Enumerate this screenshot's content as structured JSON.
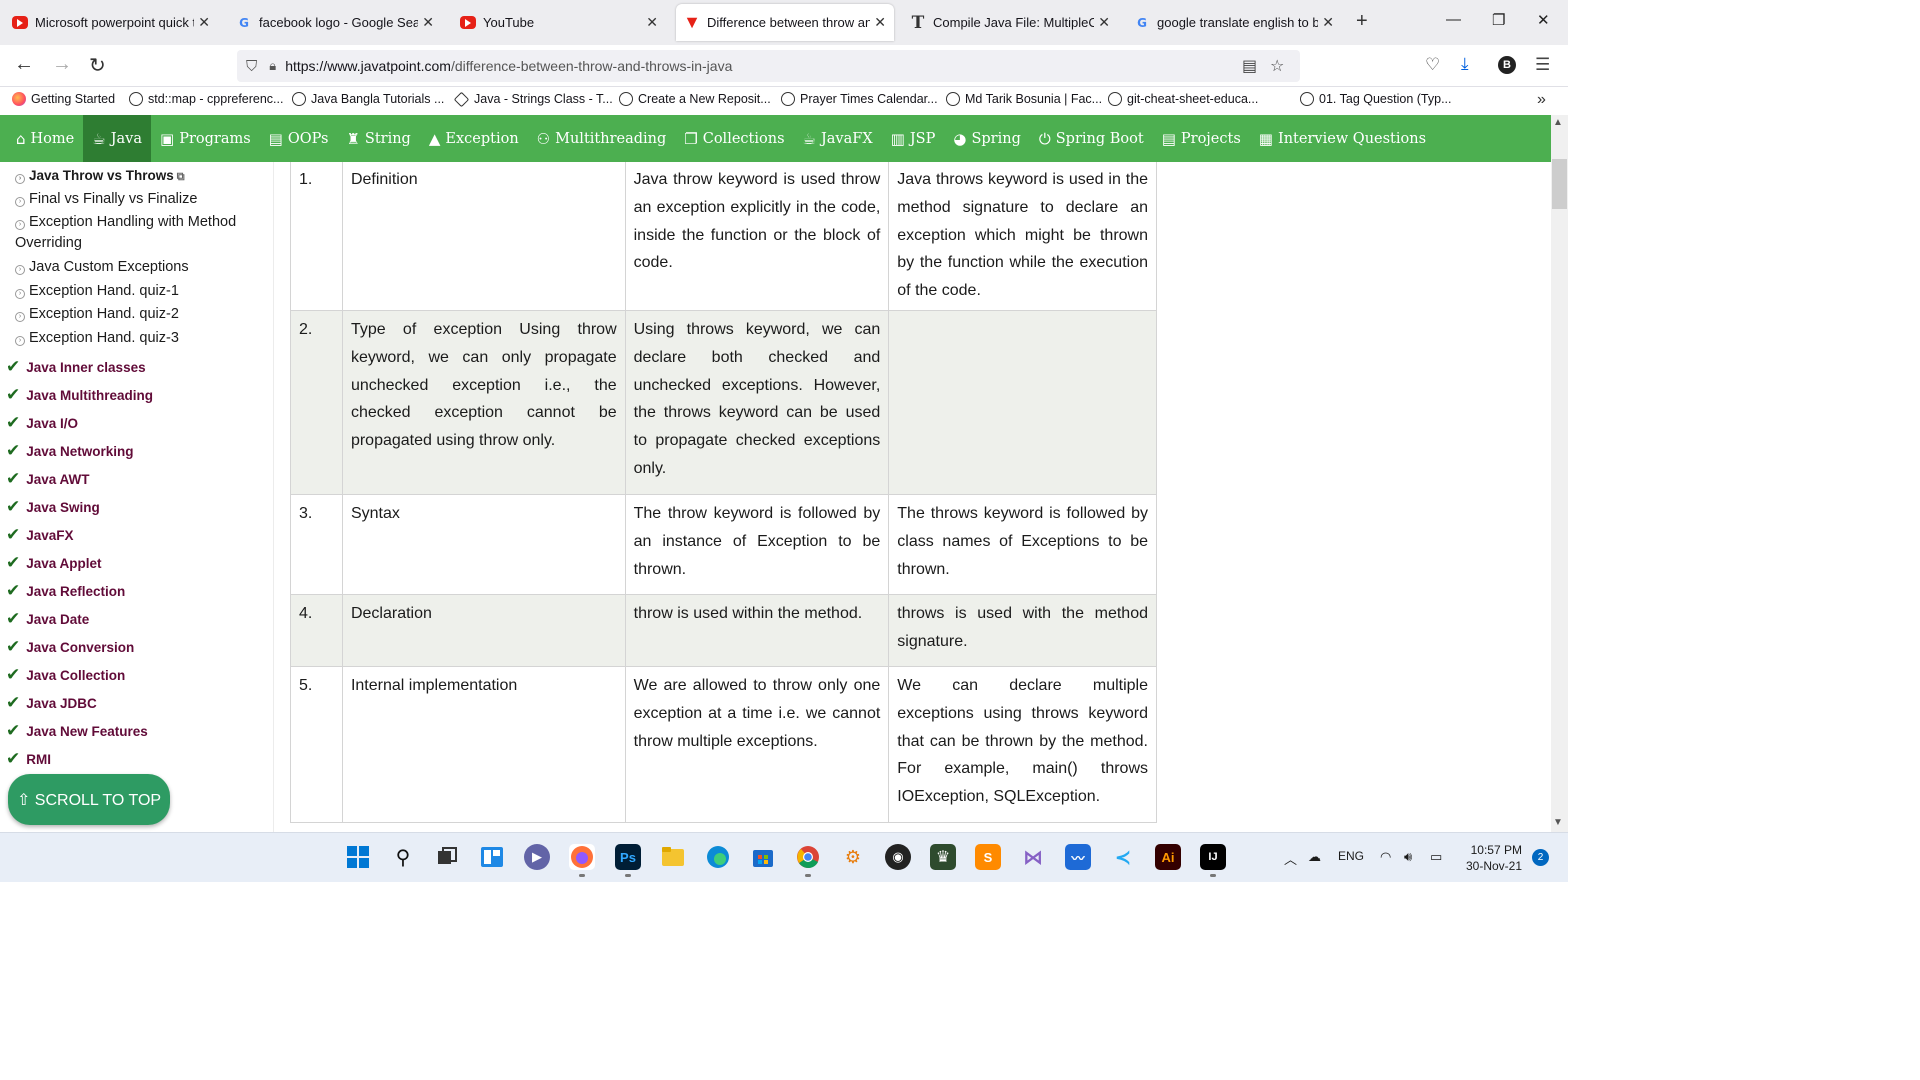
{
  "browser": {
    "tabs": [
      {
        "title": "Microsoft powerpoint quick tu",
        "favicon": "youtube-icon",
        "active": false
      },
      {
        "title": "facebook logo - Google Searc",
        "favicon": "google-icon",
        "active": false
      },
      {
        "title": "YouTube",
        "favicon": "youtube-icon",
        "active": false
      },
      {
        "title": "Difference between throw and",
        "favicon": "javatpoint-icon",
        "active": true
      },
      {
        "title": "Compile Java File: MultipleCat",
        "favicon": "t-icon",
        "active": false
      },
      {
        "title": "google translate english to ban",
        "favicon": "google-icon",
        "active": false
      }
    ],
    "url": {
      "domain": "https://www.javatpoint.com",
      "path": "/difference-between-throw-and-throws-in-java"
    },
    "avatar_letter": "B",
    "bookmarks": [
      "Getting Started",
      "std::map - cppreferenc...",
      "Java Bangla Tutorials ...",
      "Java - Strings Class - T...",
      "Create a New Reposit...",
      "Prayer Times Calendar...",
      "Md Tarik Bosunia | Fac...",
      "git-cheat-sheet-educa...",
      "01. Tag Question (Typ..."
    ]
  },
  "site_menu": [
    {
      "label": "Home",
      "icon": "home-icon",
      "active": false
    },
    {
      "label": "Java",
      "icon": "java-cup-icon",
      "active": true
    },
    {
      "label": "Programs",
      "icon": "programs-icon",
      "active": false
    },
    {
      "label": "OOPs",
      "icon": "oops-icon",
      "active": false
    },
    {
      "label": "String",
      "icon": "string-icon",
      "active": false
    },
    {
      "label": "Exception",
      "icon": "warning-icon",
      "active": false
    },
    {
      "label": "Multithreading",
      "icon": "multithreading-icon",
      "active": false
    },
    {
      "label": "Collections",
      "icon": "collections-icon",
      "active": false
    },
    {
      "label": "JavaFX",
      "icon": "javafx-icon",
      "active": false
    },
    {
      "label": "JSP",
      "icon": "jsp-icon",
      "active": false
    },
    {
      "label": "Spring",
      "icon": "spring-icon",
      "active": false
    },
    {
      "label": "Spring Boot",
      "icon": "spring-boot-icon",
      "active": false
    },
    {
      "label": "Projects",
      "icon": "projects-icon",
      "active": false
    },
    {
      "label": "Interview Questions",
      "icon": "interview-icon",
      "active": false
    }
  ],
  "sidebar": {
    "sub_items": [
      "Java Throw vs Throws",
      "Final vs Finally vs Finalize",
      "Exception Handling with Method Overriding",
      "Java Custom Exceptions",
      "Exception Hand. quiz-1",
      "Exception Hand. quiz-2",
      "Exception Hand. quiz-3"
    ],
    "categories": [
      "Java Inner classes",
      "Java Multithreading",
      "Java I/O",
      "Java Networking",
      "Java AWT",
      "Java Swing",
      "JavaFX",
      "Java Applet",
      "Java Reflection",
      "Java Date",
      "Java Conversion",
      "Java Collection",
      "Java JDBC",
      "Java New Features",
      "RMI"
    ],
    "scroll_to_top": "⇧ SCROLL TO TOP"
  },
  "table": {
    "rows": [
      {
        "num": "1.",
        "basis": "Definition",
        "throw": "Java throw keyword is used throw an exception explicitly in the code, inside the function or the block of code.",
        "throws": "Java throws keyword is used in the method signature to declare an exception which might be thrown by the function while the execution of the code."
      },
      {
        "num": "2.",
        "basis": "Type of exception Using throw keyword, we can only propagate unchecked exception i.e., the checked exception cannot be propagated using throw only.",
        "throw": "Using throws keyword, we can declare both checked and unchecked exceptions. However, the throws keyword can be used to propagate checked exceptions only.",
        "throws": ""
      },
      {
        "num": "3.",
        "basis": "Syntax",
        "throw": "The throw keyword is followed by an instance of Exception to be thrown.",
        "throws": "The throws keyword is followed by class names of Exceptions to be thrown."
      },
      {
        "num": "4.",
        "basis": "Declaration",
        "throw": "throw is used within the method.",
        "throws": "throws is used with the method signature."
      },
      {
        "num": "5.",
        "basis": "Internal implementation",
        "throw": "We are allowed to throw only one exception at a time i.e. we cannot throw multiple exceptions.",
        "throws": "We can declare multiple exceptions using throws keyword that can be thrown by the method. For example, main() throws IOException, SQLException."
      }
    ]
  },
  "taskbar": {
    "apps": [
      "windows-start-icon",
      "search-icon",
      "task-view-icon",
      "widgets-icon",
      "chat-icon",
      "firefox-icon",
      "photoshop-icon",
      "file-explorer-icon",
      "edge-icon",
      "store-icon",
      "chrome-icon",
      "blender-icon",
      "obs-icon",
      "chess-icon",
      "sublime-icon",
      "visual-studio-icon",
      "whiteboard-icon",
      "vscode-icon",
      "illustrator-icon",
      "intellij-icon"
    ],
    "tray_lang": "ENG",
    "time": "10:57 PM",
    "date": "30-Nov-21",
    "notifications": "2"
  },
  "colors": {
    "site_green": "#4caf50",
    "site_green_active": "#2e7d32",
    "category_text": "#610b38",
    "scroll_button": "#2e9b63"
  }
}
